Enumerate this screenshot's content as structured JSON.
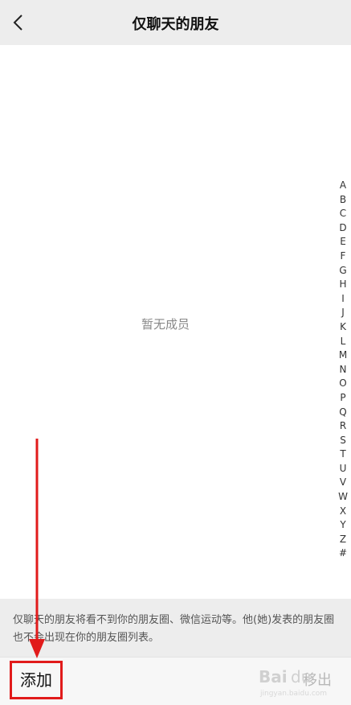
{
  "header": {
    "title": "仅聊天的朋友",
    "back_icon": "chevron-left-icon"
  },
  "main": {
    "empty_text": "暂无成员"
  },
  "index_bar": {
    "letters": [
      "A",
      "B",
      "C",
      "D",
      "E",
      "F",
      "G",
      "H",
      "I",
      "J",
      "K",
      "L",
      "M",
      "N",
      "O",
      "P",
      "Q",
      "R",
      "S",
      "T",
      "U",
      "V",
      "W",
      "X",
      "Y",
      "Z",
      "#"
    ]
  },
  "note": {
    "text": "仅聊天的朋友将看不到你的朋友圈、微信运动等。他(她)发表的朋友圈也不会出现在你的朋友圈列表。"
  },
  "footer": {
    "add_label": "添加",
    "remove_label": "移出"
  },
  "colors": {
    "annotation_red": "#e11b1b",
    "header_bg": "#ededed"
  }
}
